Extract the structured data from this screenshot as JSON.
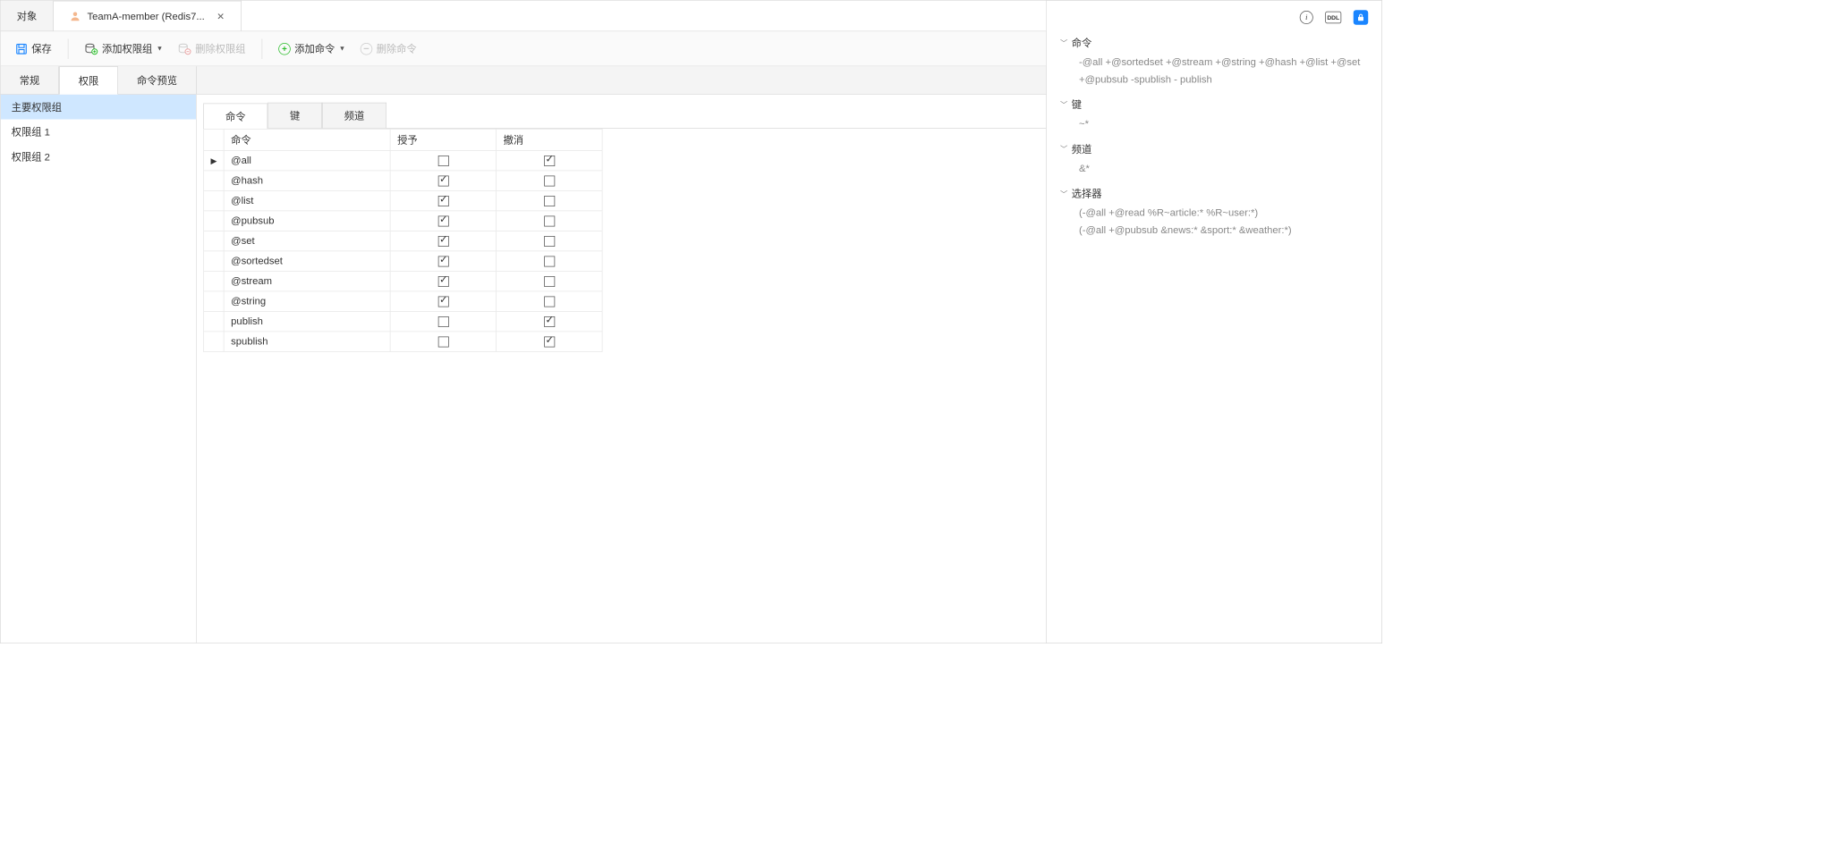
{
  "win_tabs": {
    "objects": "对象",
    "member": "TeamA-member (Redis7..."
  },
  "toolbar": {
    "save": "保存",
    "add_group": "添加权限组",
    "del_group": "删除权限组",
    "add_cmd": "添加命令",
    "del_cmd": "删除命令"
  },
  "page_tabs": {
    "general": "常规",
    "perm": "权限",
    "preview": "命令预览"
  },
  "perm_groups": [
    "主要权限组",
    "权限组 1",
    "权限组 2"
  ],
  "inner_tabs": {
    "cmd": "命令",
    "key": "键",
    "channel": "频道"
  },
  "table": {
    "col_cmd": "命令",
    "col_grant": "授予",
    "col_revoke": "撤消",
    "rows": [
      {
        "cmd": "@all",
        "grant": false,
        "revoke": true,
        "current": true
      },
      {
        "cmd": "@hash",
        "grant": true,
        "revoke": false
      },
      {
        "cmd": "@list",
        "grant": true,
        "revoke": false
      },
      {
        "cmd": "@pubsub",
        "grant": true,
        "revoke": false
      },
      {
        "cmd": "@set",
        "grant": true,
        "revoke": false
      },
      {
        "cmd": "@sortedset",
        "grant": true,
        "revoke": false
      },
      {
        "cmd": "@stream",
        "grant": true,
        "revoke": false
      },
      {
        "cmd": "@string",
        "grant": true,
        "revoke": false
      },
      {
        "cmd": "publish",
        "grant": false,
        "revoke": true
      },
      {
        "cmd": "spublish",
        "grant": false,
        "revoke": true
      }
    ]
  },
  "right_panel": {
    "ddl_label": "DDL",
    "sections": {
      "cmd": {
        "title": "命令",
        "body": "-@all +@sortedset +@stream +@string +@hash +@list +@set +@pubsub -spublish - publish"
      },
      "key": {
        "title": "键",
        "body": "~*"
      },
      "channel": {
        "title": "频道",
        "body": "&*"
      },
      "selector": {
        "title": "选择器",
        "body1": "(-@all +@read %R~article:* %R~user:*)",
        "body2": "(-@all +@pubsub &news:* &sport:* &weather:*)"
      }
    }
  }
}
